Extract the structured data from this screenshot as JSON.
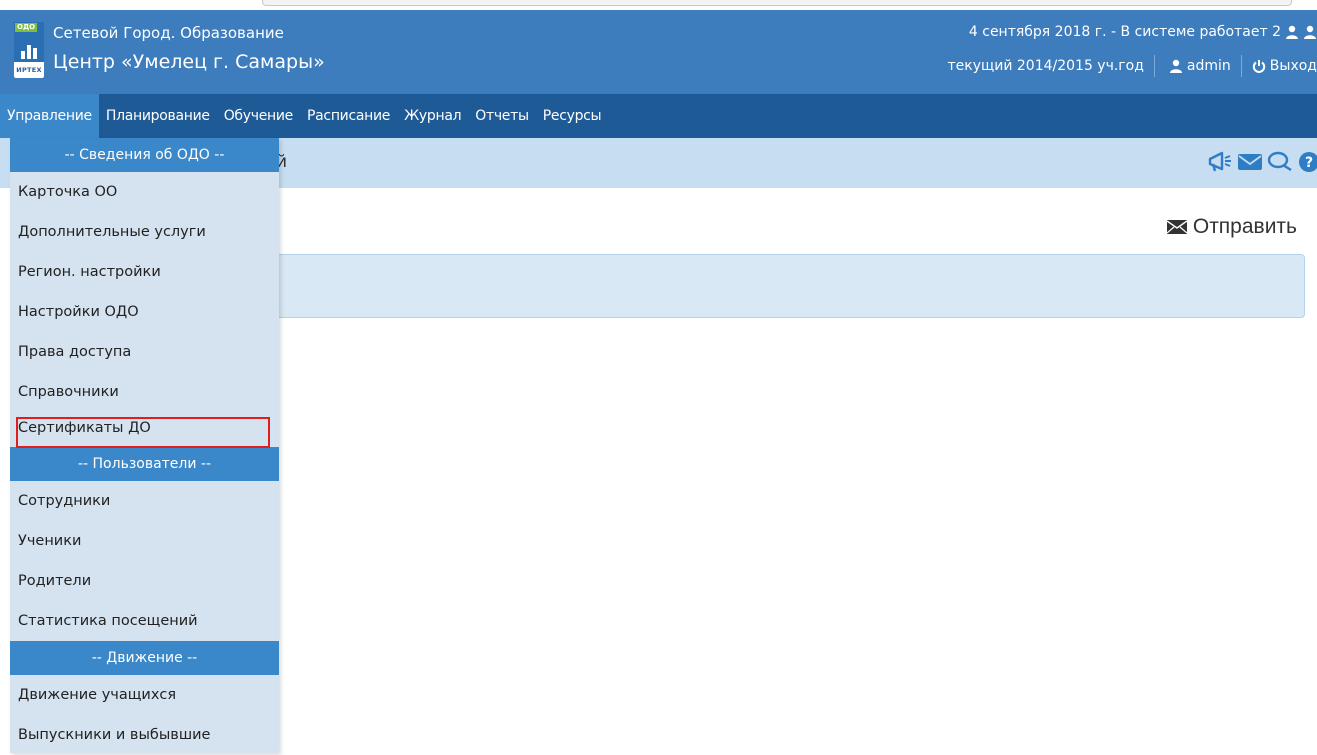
{
  "header": {
    "logo_tag": "ОДО",
    "logo_text": "ИРТЕХ",
    "app_title": "Сетевой Город. Образование",
    "org_name": "Центр «Умелец г. Самары»",
    "date_status": "4 сентября 2018 г. - В системе работает 2",
    "current_year": "текущий 2014/2015 уч.год",
    "user": "admin",
    "logout": "Выход"
  },
  "menu": {
    "items": [
      {
        "label": "Управление"
      },
      {
        "label": "Планирование"
      },
      {
        "label": "Обучение"
      },
      {
        "label": "Расписание"
      },
      {
        "label": "Журнал"
      },
      {
        "label": "Отчеты"
      },
      {
        "label": "Ресурсы"
      }
    ]
  },
  "page": {
    "title_fragment": "й",
    "send_label": "Отправить"
  },
  "dropdown": {
    "sections": [
      {
        "header": "-- Сведения об ОДО --",
        "items": [
          "Карточка ОО",
          "Дополнительные услуги",
          "Регион. настройки",
          "Настройки ОДО",
          "Права доступа",
          "Справочники",
          "Сертификаты ДО"
        ]
      },
      {
        "header": "-- Пользователи --",
        "items": [
          "Сотрудники",
          "Ученики",
          "Родители",
          "Статистика посещений"
        ]
      },
      {
        "header": "-- Движение --",
        "items": [
          "Движение учащихся",
          "Выпускники и выбывшие"
        ]
      }
    ]
  },
  "colors": {
    "header_bg": "#3d7cbd",
    "menubar_bg": "#1d5a96",
    "active_menu": "#3a88c9",
    "dropdown_bg": "#d5e3f0",
    "highlight_border": "#e01e1e"
  },
  "icons": [
    "megaphone-icon",
    "envelope-icon",
    "chat-icon",
    "help-icon",
    "person-icon",
    "power-icon"
  ]
}
